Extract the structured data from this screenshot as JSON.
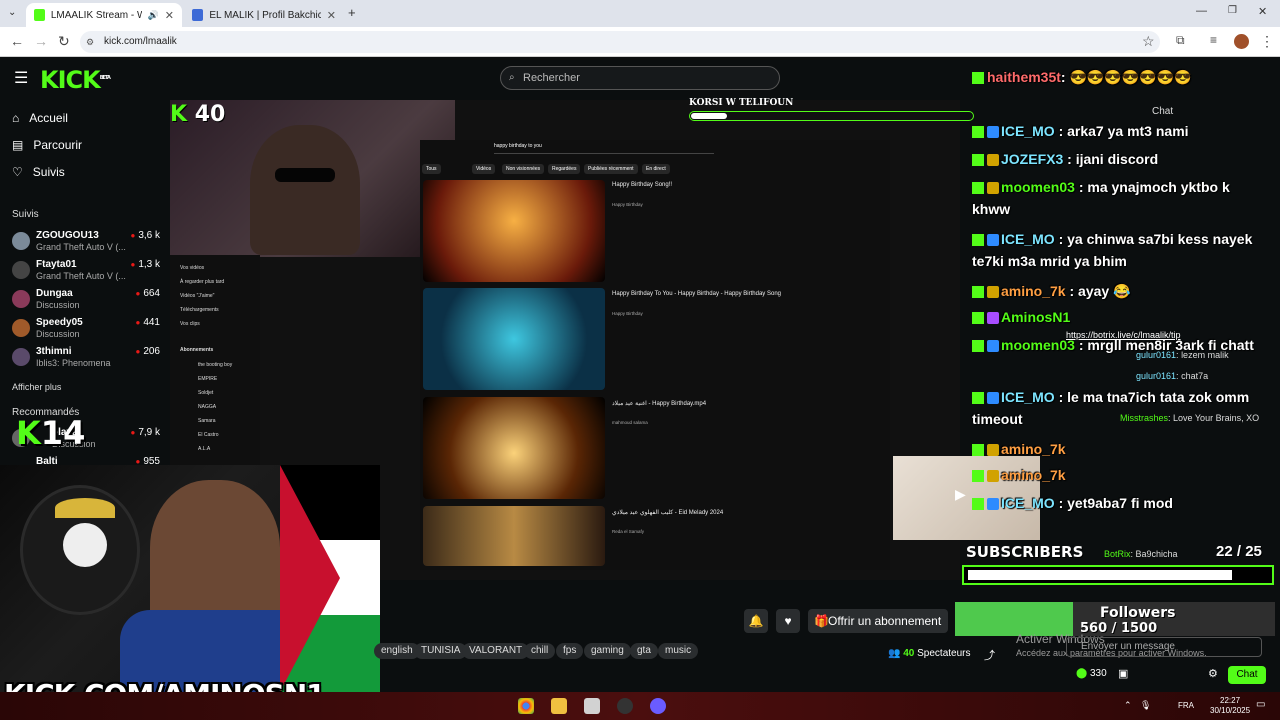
{
  "browser": {
    "tabs": [
      {
        "title": "LMAALIK Stream - Watch L",
        "active": true
      },
      {
        "title": "EL MALIK | Profil Bakchich | Ba",
        "active": false
      }
    ],
    "url": "kick.com/lmaalik"
  },
  "kick": {
    "logo": "KICK",
    "logo_sup": "BETA",
    "search_placeholder": "Rechercher",
    "nav": [
      "Accueil",
      "Parcourir",
      "Suivis"
    ],
    "followed_heading": "Suivis",
    "followed": [
      {
        "name": "ZGOUGOU13",
        "game": "Grand Theft Auto V (...",
        "viewers": "3,6 k"
      },
      {
        "name": "Ftayta01",
        "game": "Grand Theft Auto V (...",
        "viewers": "1,3 k"
      },
      {
        "name": "Dungaa",
        "game": "Discussion",
        "viewers": "664"
      },
      {
        "name": "Speedy05",
        "game": "Discussion",
        "viewers": "441"
      },
      {
        "name": "3thimni",
        "game": "Iblis3: Phenomena",
        "viewers": "206"
      }
    ],
    "show_more": "Afficher plus",
    "recommended_heading": "Recommandés",
    "recommended": [
      {
        "name": "olava",
        "game": "Discussion",
        "viewers": "7,9 k"
      },
      {
        "name": "Balti",
        "game": "",
        "viewers": "955"
      }
    ]
  },
  "stream": {
    "overlay_k_count": "40",
    "overlay_k2": "14",
    "banner_title": "KORSI W TELIFOUN",
    "big_url": "KICK.COM/AMINOSN1",
    "yt_search": "happy birthday to you",
    "yt_chips": [
      "Tous",
      "Vidéos",
      "Non visionnées",
      "Regardées",
      "Publiées récemment",
      "En direct"
    ],
    "yt_nav": [
      "Vos vidéos",
      "À regarder plus tard",
      "Vidéos \"J'aime\"",
      "Téléchargements",
      "Vos clips"
    ],
    "yt_subs_heading": "Abonnements",
    "yt_subs": [
      "the booting boy",
      "EMPIRE",
      "Soldjet",
      "NAGGA",
      "Samara",
      "El Castro",
      "A.L.A"
    ],
    "yt_videos": [
      {
        "title": "Happy Birthday Song!!",
        "meta": "Happy Birthday"
      },
      {
        "title": "Happy Birthday To You - Happy Birthday - Happy Birthday Song",
        "meta": "Happy Birthday"
      },
      {
        "title": "اغنية عيد ميلاد - Happy Birthday.mp4",
        "meta": "mahmoud salama"
      },
      {
        "title": "كليب الفهلوي عيد ميلادي - Eid Melady 2024",
        "meta": "Reda el Samafy"
      }
    ],
    "overlay_chat": [
      {
        "user": "haithem35t",
        "text": ": 😎😎😎😎😎😎😎"
      },
      {
        "user": "ICE_MO",
        "text": ": arka7 ya mt3 nami"
      },
      {
        "user": "JOZEFX3",
        "text": ": ijani discord"
      },
      {
        "user": "moomen03",
        "text": ": ma ynajmoch yktbo k khww"
      },
      {
        "user": "ICE_MO",
        "text": ": ya chinwa sa7bi kess nayek te7ki m3a mrid ya bhim"
      },
      {
        "user": "amino_7k",
        "text": ": ayay 😂"
      },
      {
        "user": "AminosN1",
        "text": ""
      },
      {
        "user": "moomen03",
        "text": ": mrgll men8ir 3ark fi chatt"
      },
      {
        "user": "ICE_MO",
        "text": ": le ma tna7ich tata zok omm timeout"
      },
      {
        "user": "amino_7k",
        "text": ""
      },
      {
        "user": "amino_7k",
        "text": ""
      },
      {
        "user": "ICE_MO",
        "text": ": yet9aba7 fi mod"
      }
    ],
    "subscribers_label": "SUBSCRIBERS",
    "subscribers_value": "22",
    "subscribers_goal": "25",
    "subscribers_progress": 0.88,
    "followers_label": "Followers",
    "followers_value": "560",
    "followers_goal": "1500",
    "followers_progress": 0.37
  },
  "chat_panel": {
    "title": "Chat",
    "donation_link": "https://botrix.live/c/lmaalik/tip",
    "messages": [
      {
        "user": "gulur0161",
        "text": "lezem malik"
      },
      {
        "user": "gulur0161",
        "text": "chat7a"
      },
      {
        "user": "Misstrashes",
        "text": "Love Your Brains, XO"
      },
      {
        "user": "BotRix",
        "text": "Ba9chicha"
      }
    ],
    "input_placeholder": "Envoyer un message",
    "send_label": "Chat",
    "points": "330"
  },
  "controls": {
    "subscribe_label": "Offrir un abonnement",
    "tags": [
      "english",
      "TUNISIA",
      "VALORANT",
      "chill",
      "fps",
      "gaming",
      "gta",
      "music"
    ],
    "viewers": "40",
    "viewers_label": "Spectateurs"
  },
  "windows": {
    "watermark": "Activer Windows",
    "watermark_sub": "Accédez aux paramètres pour activer Windows.",
    "lang": "FRA",
    "time": "22:27",
    "date": "30/10/2025"
  },
  "colors": {
    "kick_green": "#53fc18",
    "taskbar": "#4b0e0e"
  }
}
